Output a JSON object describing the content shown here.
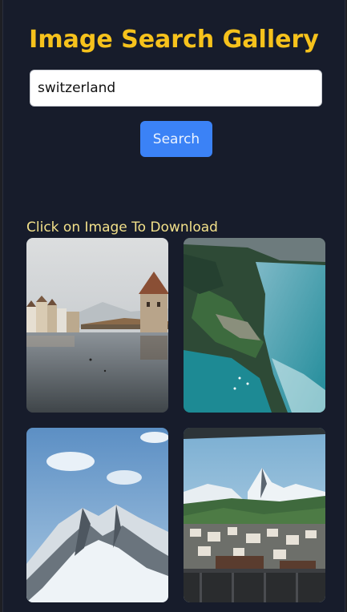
{
  "app": {
    "title": "Image Search Gallery"
  },
  "search": {
    "value": "switzerland",
    "button_label": "Search"
  },
  "gallery": {
    "hint": "Click on Image To Download",
    "images": [
      {
        "subject": "lakeside town with tower and covered bridge"
      },
      {
        "subject": "aerial view of turquoise lake and shoreline"
      },
      {
        "subject": "snow-covered mountain peaks"
      },
      {
        "subject": "alpine village below Matterhorn"
      }
    ]
  },
  "colors": {
    "accent": "#f6c21c",
    "button": "#3b82f6",
    "background": "#171c2b",
    "hint": "#f2e08a"
  }
}
